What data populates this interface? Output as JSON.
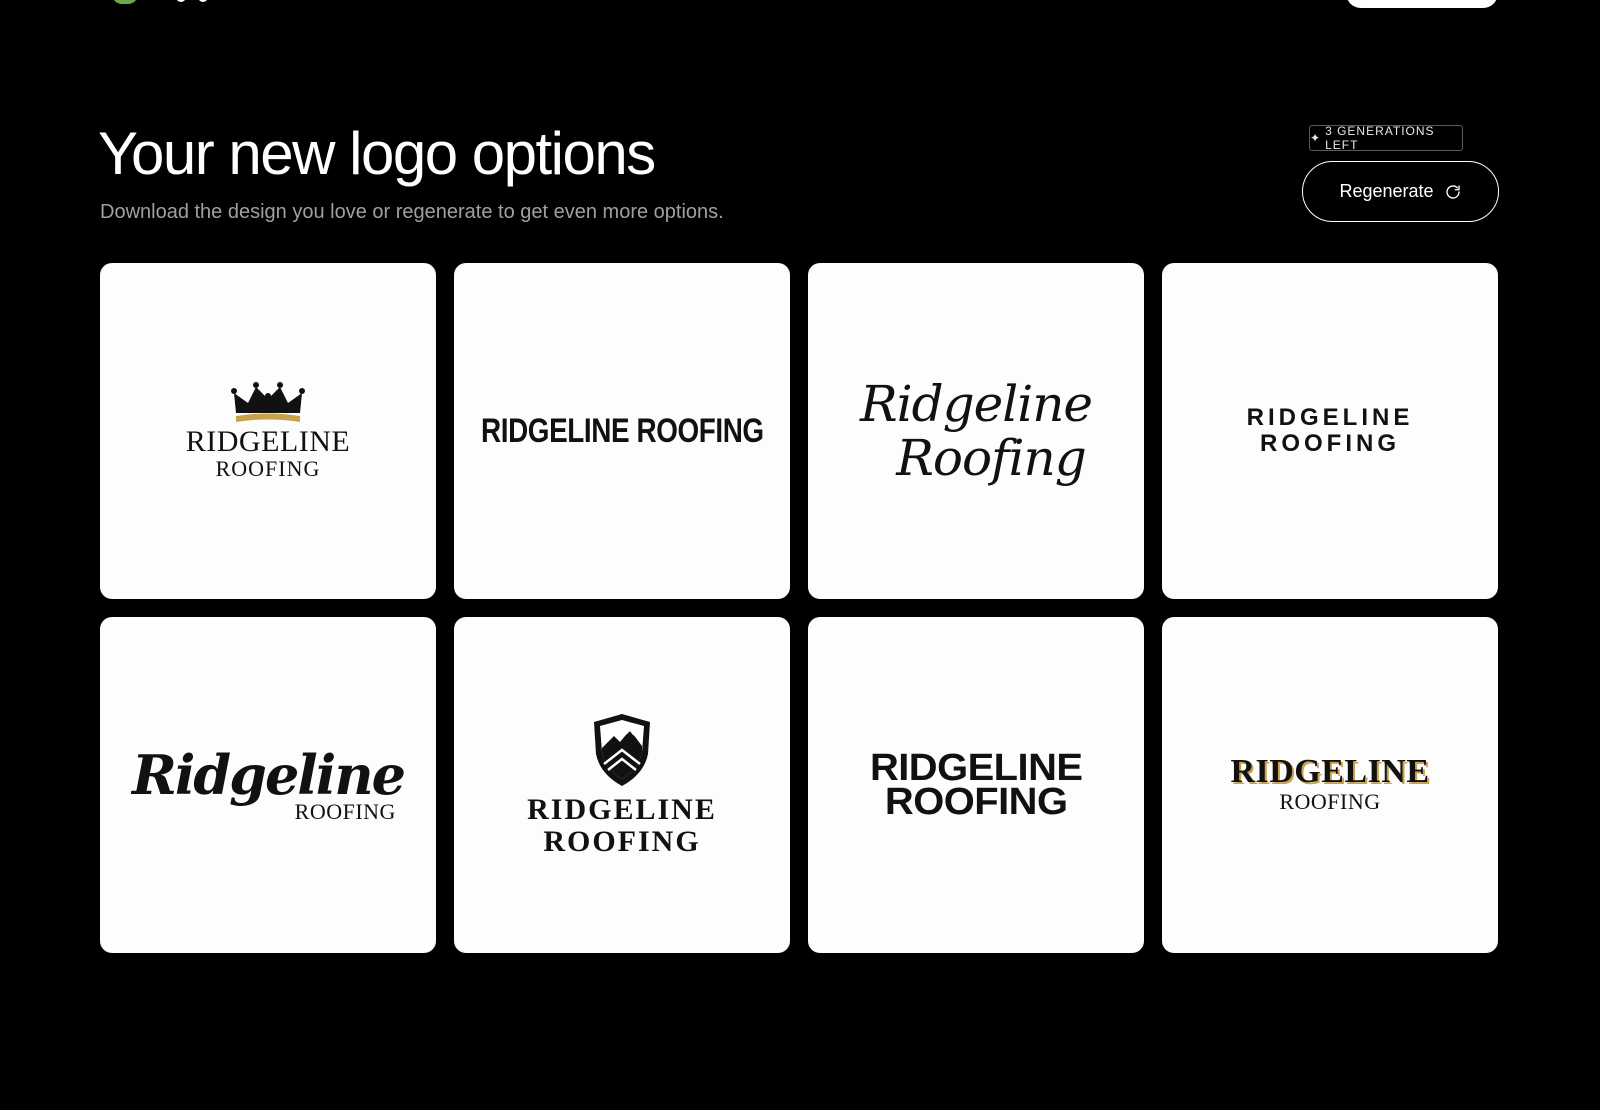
{
  "header": {
    "title": "Your new logo options",
    "subtitle": "Download the design you love or regenerate to get even more options."
  },
  "generations": {
    "icon": "sparkle-icon",
    "label": "3 GENERATIONS LEFT"
  },
  "regenerate": {
    "label": "Regenerate",
    "icon": "refresh-icon"
  },
  "logos": [
    {
      "line1": "RIDGELINE",
      "line2": "ROOFING",
      "style": "serif-crown",
      "accent": "#c8a24a"
    },
    {
      "line1": "RIDGELINE ROOFING",
      "style": "condensed-stencil"
    },
    {
      "line1": "Ridgeline",
      "line2": "Roofing",
      "style": "script"
    },
    {
      "line1": "RIDGELINE",
      "line2": "ROOFING",
      "style": "spaced-sans"
    },
    {
      "line1": "Ridgeline",
      "line2": "ROOFING",
      "style": "brush-script"
    },
    {
      "line1": "RIDGELINE",
      "line2": "ROOFING",
      "style": "shield-serif"
    },
    {
      "line1": "RIDGELINE",
      "line2": "ROOFING",
      "style": "heavy-sans"
    },
    {
      "line1": "RIDGELINE",
      "line2": "ROOFING",
      "style": "gold-serif",
      "accent": "#c8a24a"
    }
  ],
  "colors": {
    "background": "#000000",
    "card": "#fdfdfd",
    "text": "#ffffff",
    "muted": "#a0a0a0"
  }
}
